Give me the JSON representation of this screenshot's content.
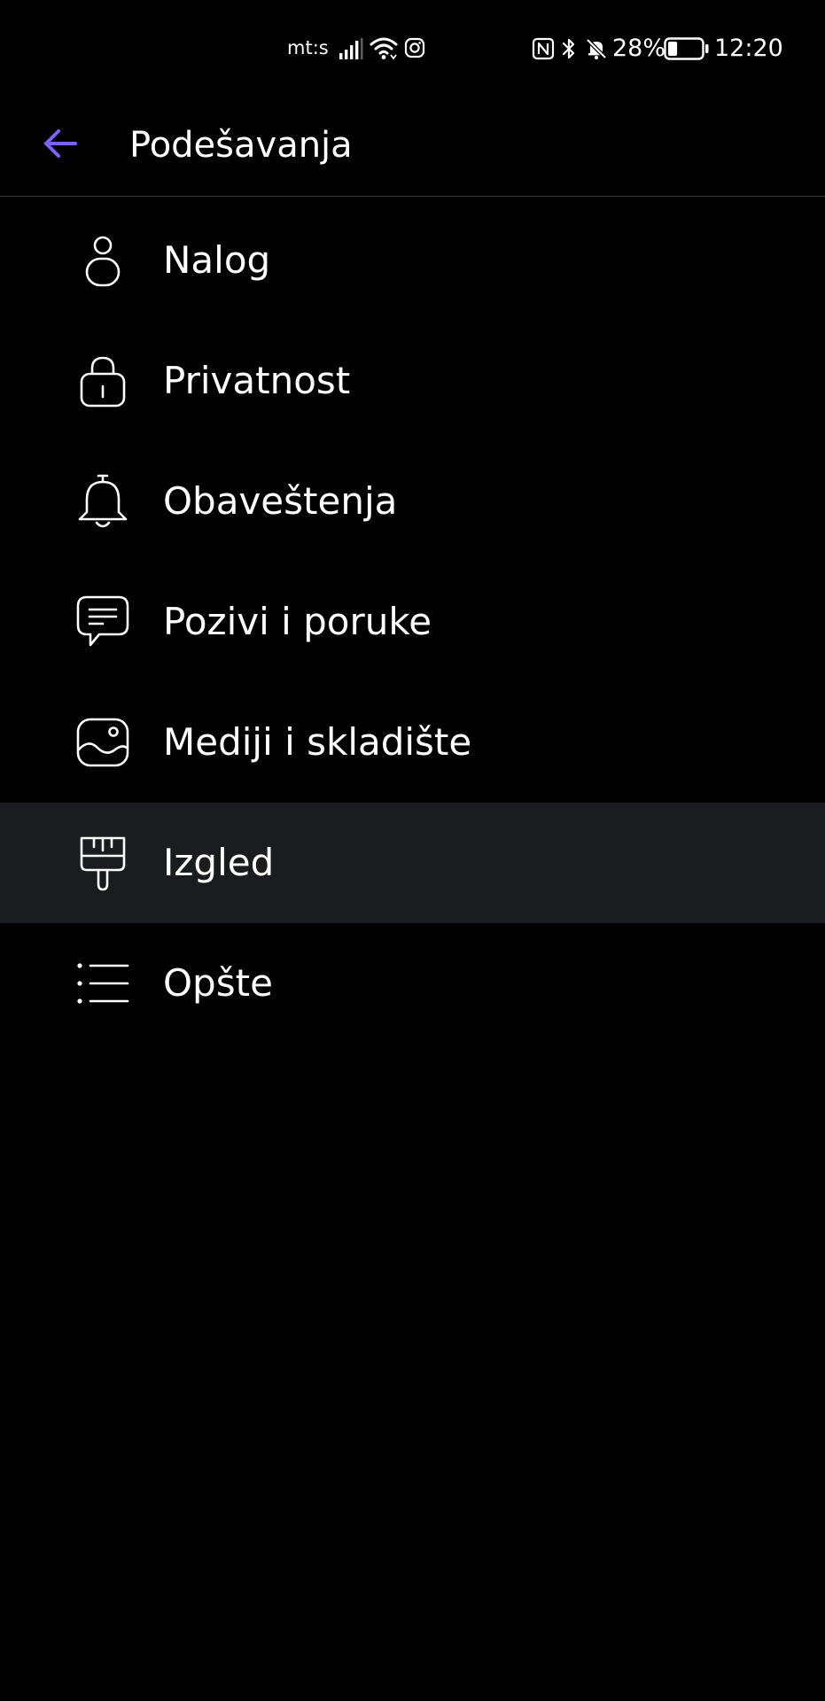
{
  "status_bar": {
    "carrier": "mt:s",
    "battery_percent": "28%",
    "battery_level": 0.28,
    "time": "12:20",
    "icons": [
      "signal-icon",
      "wifi-icon",
      "instagram-icon",
      "nfc-icon",
      "bluetooth-icon",
      "notifications-muted-icon",
      "battery-icon"
    ]
  },
  "app_bar": {
    "back_icon": "arrow-left-icon",
    "title": "Podešavanja"
  },
  "colors": {
    "background": "#000000",
    "accent": "#7b61ff",
    "selected_row": "#1b1c1f",
    "divider": "#3a3a3e",
    "text": "#ffffff"
  },
  "settings": {
    "items": [
      {
        "label": "Nalog",
        "icon": "person-icon",
        "selected": false
      },
      {
        "label": "Privatnost",
        "icon": "lock-icon",
        "selected": false
      },
      {
        "label": "Obaveštenja",
        "icon": "bell-icon",
        "selected": false
      },
      {
        "label": "Pozivi i poruke",
        "icon": "chat-bubble-icon",
        "selected": false
      },
      {
        "label": "Mediji i skladište",
        "icon": "image-icon",
        "selected": false
      },
      {
        "label": "Izgled",
        "icon": "paintbrush-icon",
        "selected": true
      },
      {
        "label": "Opšte",
        "icon": "list-icon",
        "selected": false
      }
    ]
  }
}
